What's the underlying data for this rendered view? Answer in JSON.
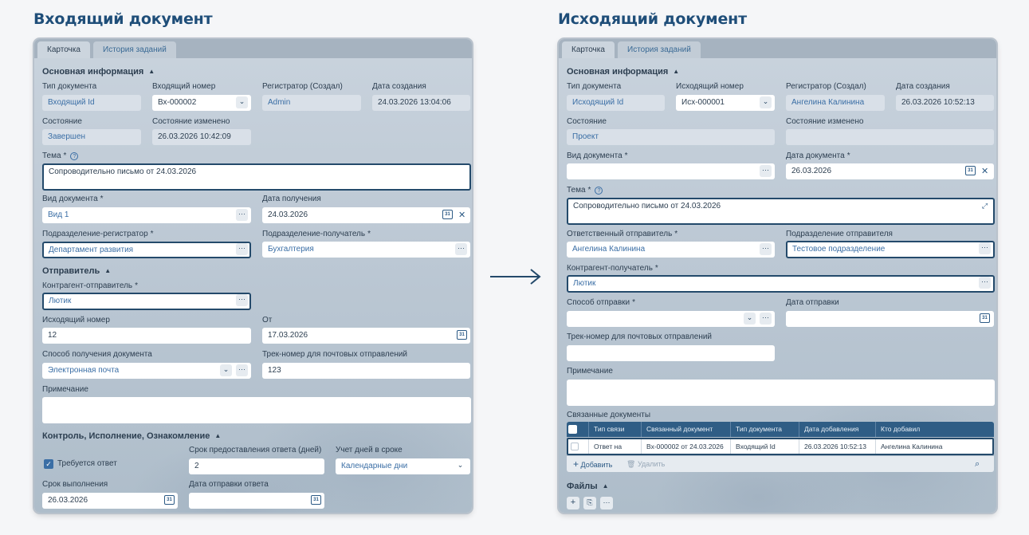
{
  "left": {
    "title": "Входящий документ",
    "tabs": [
      "Карточка",
      "История заданий"
    ],
    "main_section": "Основная информация",
    "doc_type_label": "Тип документа",
    "doc_type": "Входящий Id",
    "in_number_label": "Входящий номер",
    "in_number": "Вх-000002",
    "registrar_label": "Регистратор (Создал)",
    "registrar": "Admin",
    "created_label": "Дата создания",
    "created": "24.03.2026 13:04:06",
    "state_label": "Состояние",
    "state": "Завершен",
    "state_changed_label": "Состояние изменено",
    "state_changed": "26.03.2026 10:42:09",
    "subject_label": "Тема",
    "required_mark": "*",
    "help": "?",
    "subject": "Сопроводительно письмо от 24.03.2026",
    "kind_label": "Вид документа",
    "kind": "Вид 1",
    "received_label": "Дата получения",
    "received": "24.03.2026",
    "reg_dept_label": "Подразделение-регистратор",
    "reg_dept": "Департамент развития",
    "recv_dept_label": "Подразделение-получатель",
    "recv_dept": "Бухгалтерия",
    "sender_section": "Отправитель",
    "sender_label": "Контрагент-отправитель",
    "sender": "Лютик",
    "out_number_label": "Исходящий номер",
    "out_number": "12",
    "from_label": "От",
    "from": "17.03.2026",
    "method_label": "Способ получения документа",
    "method": "Электронная почта",
    "track_label": "Трек-номер для почтовых отправлений",
    "track": "123",
    "note_label": "Примечание",
    "control_section": "Контроль, Исполнение, Ознакомление",
    "answer_required": "Требуется ответ",
    "answer_days_label": "Срок предоставления ответа (дней)",
    "answer_days": "2",
    "days_count_label": "Учет дней в сроке",
    "days_count": "Календарные дни",
    "deadline_label": "Срок выполнения",
    "deadline": "26.03.2026",
    "answer_sent_label": "Дата отправки ответа"
  },
  "right": {
    "title": "Исходящий документ",
    "tabs": [
      "Карточка",
      "История заданий"
    ],
    "main_section": "Основная информация",
    "doc_type_label": "Тип документа",
    "doc_type": "Исходящий Id",
    "out_number_label": "Исходящий номер",
    "out_number": "Исх-000001",
    "registrar_label": "Регистратор (Создал)",
    "registrar": "Ангелина Калинина",
    "created_label": "Дата создания",
    "created": "26.03.2026 10:52:13",
    "state_label": "Состояние",
    "state": "Проект",
    "state_changed_label": "Состояние изменено",
    "kind_label": "Вид документа",
    "doc_date_label": "Дата документа",
    "doc_date": "26.03.2026",
    "subject_label": "Тема",
    "subject": "Сопроводительно письмо от 24.03.2026",
    "sender_label": "Ответственный отправитель",
    "sender": "Ангелина Калинина",
    "sender_dept_label": "Подразделение отправителя",
    "sender_dept": "Тестовое подразделение",
    "recipient_label": "Контрагент-получатель",
    "recipient": "Лютик",
    "send_method_label": "Способ отправки",
    "send_date_label": "Дата отправки",
    "track_label": "Трек-номер для почтовых отправлений",
    "note_label": "Примечание",
    "linked_label": "Связанные документы",
    "linked_columns": [
      "Тип связи",
      "Связанный документ",
      "Тип документа",
      "Дата добавления",
      "Кто добавил"
    ],
    "linked_row": [
      "Ответ на",
      "Вх-000002 от 24.03.2026",
      "Входящий Id",
      "26.03.2026 10:52:13",
      "Ангелина Калинина"
    ],
    "add_label": "Добавить",
    "delete_label": "Удалить",
    "files_section": "Файлы"
  },
  "icons": {
    "ellipsis": "…",
    "chevron": "⌄",
    "calendar": "31",
    "close": "✕",
    "check": "✓",
    "search": "⌕",
    "plus": "+",
    "trash": "🗑",
    "expand": "⤢"
  },
  "colors": {
    "title": "#1f4e79",
    "accent": "#3a6ea5",
    "highlight_border": "#244a6b",
    "table_header": "#2f5d85"
  }
}
